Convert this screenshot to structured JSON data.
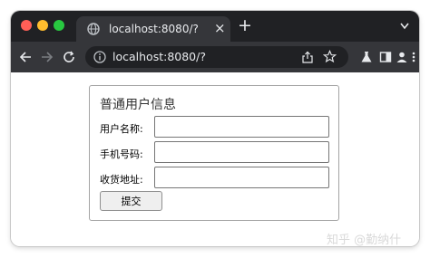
{
  "browser": {
    "tab": {
      "title": "localhost:8080/?",
      "favicon": "globe-icon",
      "close_glyph": "×"
    },
    "new_tab_glyph": "+",
    "address_bar": {
      "url": "localhost:8080/?",
      "site_info_icon": "info-icon"
    },
    "toolbar_icons": [
      "back-arrow-icon",
      "forward-arrow-icon",
      "reload-icon",
      "share-icon",
      "bookmark-star-icon",
      "flask-icon",
      "sidebar-icon",
      "profile-icon",
      "more-menu-icon"
    ]
  },
  "form": {
    "legend": "普通用户信息",
    "fields": [
      {
        "label": "用户名称:",
        "value": ""
      },
      {
        "label": "手机号码:",
        "value": ""
      },
      {
        "label": "收货地址:",
        "value": ""
      }
    ],
    "submit_label": "提交"
  },
  "watermark": "知乎 @勤纳什",
  "colors": {
    "tabstrip_bg": "#202124",
    "toolbar_bg": "#35363a",
    "traffic_red": "#ff5f57",
    "traffic_yellow": "#febc2e",
    "traffic_green": "#28c840"
  }
}
